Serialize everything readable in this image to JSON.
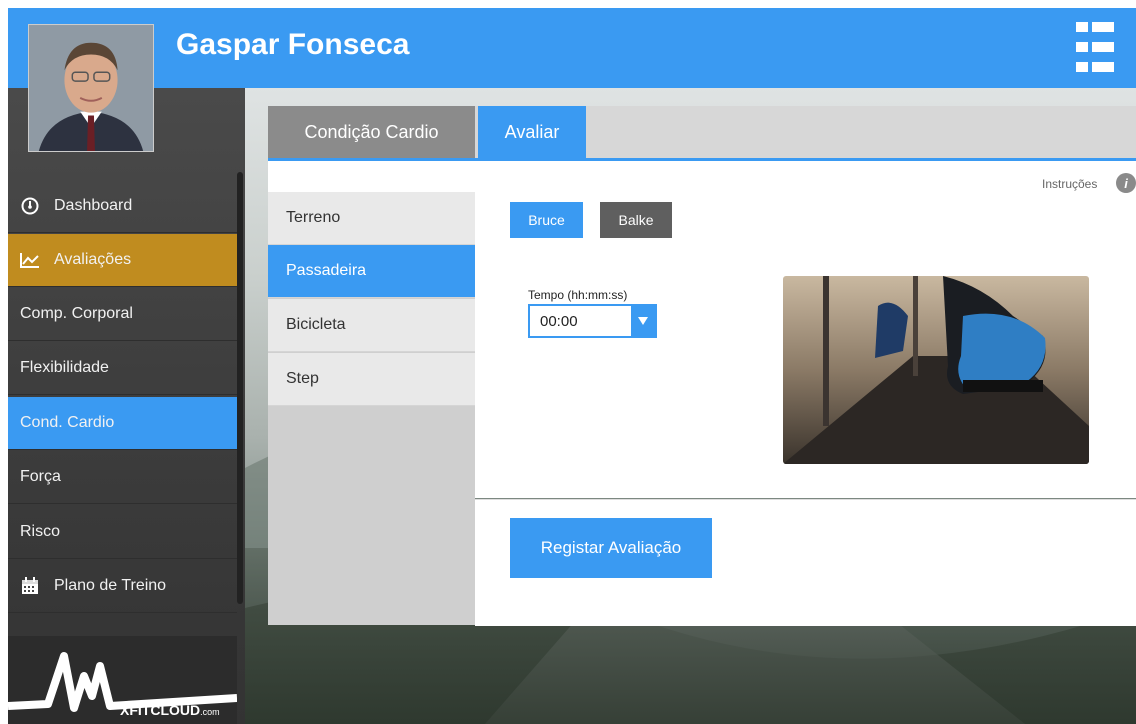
{
  "header": {
    "user_name": "Gaspar Fonseca"
  },
  "sidebar": {
    "items": [
      {
        "label": "Dashboard",
        "icon": "dashboard-gauge-icon"
      },
      {
        "label": "Avaliações",
        "icon": "line-chart-icon"
      },
      {
        "label": "Comp. Corporal"
      },
      {
        "label": "Flexibilidade"
      },
      {
        "label": "Cond. Cardio"
      },
      {
        "label": "Força"
      },
      {
        "label": "Risco"
      },
      {
        "label": "Plano de Treino",
        "icon": "calendar-icon"
      }
    ],
    "logo_text": "XFITCLOUD",
    "logo_suffix": ".com"
  },
  "tabs": [
    {
      "label": "Condição Cardio"
    },
    {
      "label": "Avaliar"
    }
  ],
  "sub_menu": [
    {
      "label": "Terreno"
    },
    {
      "label": "Passadeira"
    },
    {
      "label": "Bicicleta"
    },
    {
      "label": "Step"
    }
  ],
  "main": {
    "instructions_label": "Instruções",
    "protocols": [
      "Bruce",
      "Balke"
    ],
    "time_label": "Tempo (hh:mm:ss)",
    "time_value": "00:00",
    "register_label": "Registar Avaliação"
  },
  "colors": {
    "accent": "#3a9af2",
    "active_nav": "#c08c1f",
    "sidebar": "#3d3d3d"
  }
}
